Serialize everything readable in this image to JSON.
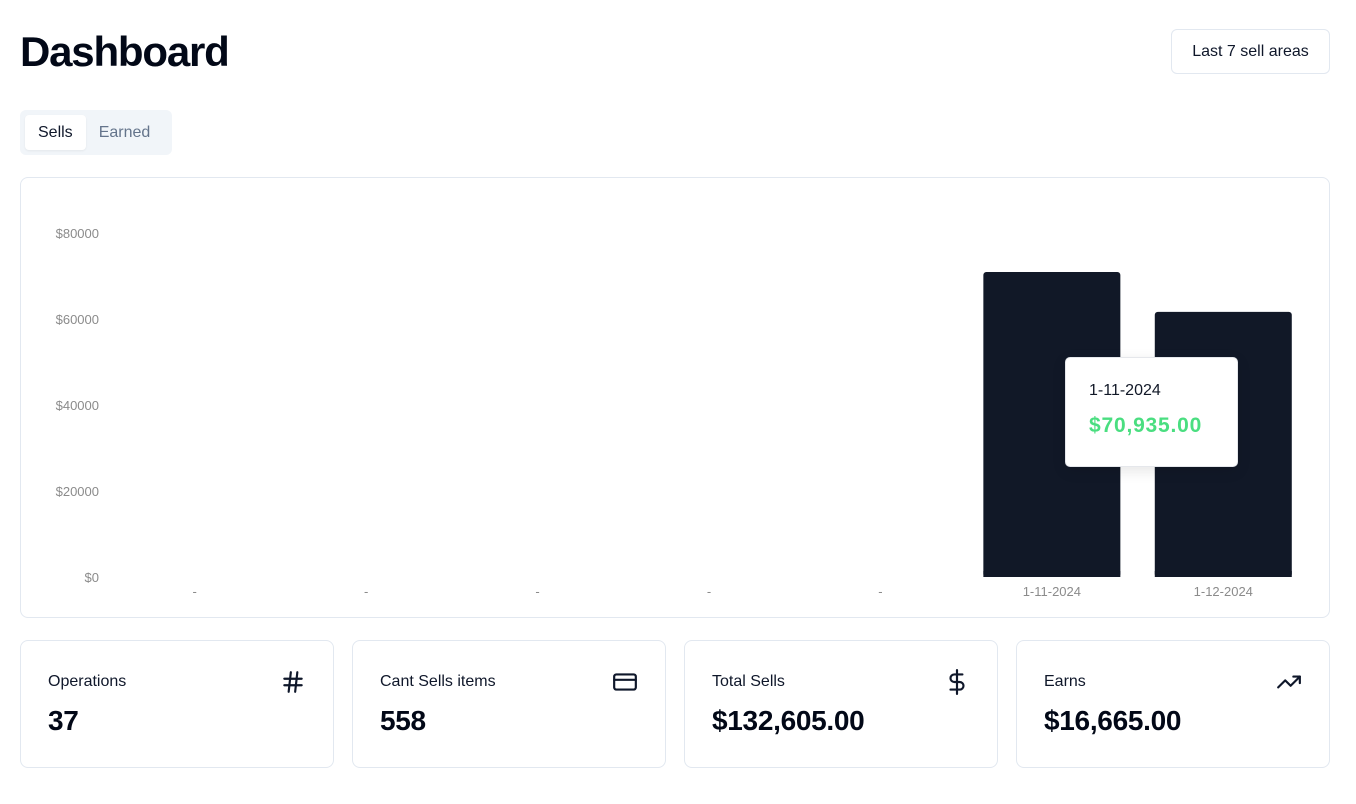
{
  "header": {
    "title": "Dashboard",
    "range_button": "Last 7 sell areas"
  },
  "tabs": [
    {
      "label": "Sells",
      "active": true
    },
    {
      "label": "Earned",
      "active": false
    }
  ],
  "tooltip": {
    "date": "1-11-2024",
    "value": "$70,935.00",
    "value_color": "#4ade80"
  },
  "chart_data": {
    "type": "bar",
    "categories": [
      "-",
      "-",
      "-",
      "-",
      "-",
      "1-11-2024",
      "1-12-2024"
    ],
    "values": [
      0,
      0,
      0,
      0,
      0,
      70935,
      61670
    ],
    "ylim": [
      0,
      80000
    ],
    "y_ticks": [
      "$0",
      "$20000",
      "$40000",
      "$60000",
      "$80000"
    ],
    "bar_color": "#111827",
    "grid": false
  },
  "stats": [
    {
      "label": "Operations",
      "value": "37",
      "icon": "hash-icon"
    },
    {
      "label": "Cant Sells items",
      "value": "558",
      "icon": "credit-card-icon"
    },
    {
      "label": "Total Sells",
      "value": "$132,605.00",
      "icon": "dollar-sign-icon"
    },
    {
      "label": "Earns",
      "value": "$16,665.00",
      "icon": "trending-up-icon"
    }
  ]
}
